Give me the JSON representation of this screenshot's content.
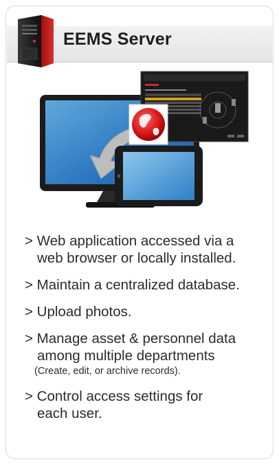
{
  "header": {
    "title": "EEMS Server",
    "icon": "server-tower-icon"
  },
  "illustration": {
    "icons": [
      "desktop-monitor-icon",
      "tablet-icon",
      "globe-icon",
      "sync-arrow-icon",
      "app-screenshot-thumbnail"
    ],
    "accent_color": "#e02020"
  },
  "features": [
    {
      "line1": "> Web application accessed via a",
      "line2": "web browser or locally installed."
    },
    {
      "line1": "> Maintain a centralized database."
    },
    {
      "line1": "> Upload photos."
    },
    {
      "line1": "> Manage asset & personnel data",
      "line2": "among multiple departments",
      "note": "(Create, edit, or archive records)."
    },
    {
      "line1": "> Control access settings for",
      "line2": "each user."
    }
  ]
}
